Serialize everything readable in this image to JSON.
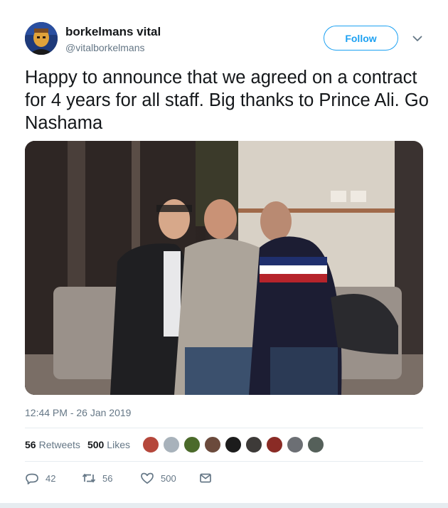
{
  "user": {
    "display_name": "borkelmans vital",
    "handle": "@vitalborkelmans"
  },
  "follow_label": "Follow",
  "more_icon": "chevron-down-icon",
  "tweet_text": "Happy to announce that we agreed on a contract for 4 years for all staff. Big thanks to Prince Ali. Go Nashama",
  "timestamp": "12:44 PM - 26 Jan 2019",
  "stats": {
    "retweets_count": "56",
    "retweets_label": "Retweets",
    "likes_count": "500",
    "likes_label": "Likes"
  },
  "liker_colors": [
    "#b5473b",
    "#a8b2bb",
    "#4b6a2a",
    "#6b4a3c",
    "#1c1c1c",
    "#3d3a38",
    "#8a2b25",
    "#6c6f74",
    "#55605a"
  ],
  "actions": {
    "reply_count": "42",
    "retweet_count": "56",
    "like_count": "500"
  },
  "colors": {
    "accent": "#1da1f2",
    "secondary_text": "#657786"
  }
}
